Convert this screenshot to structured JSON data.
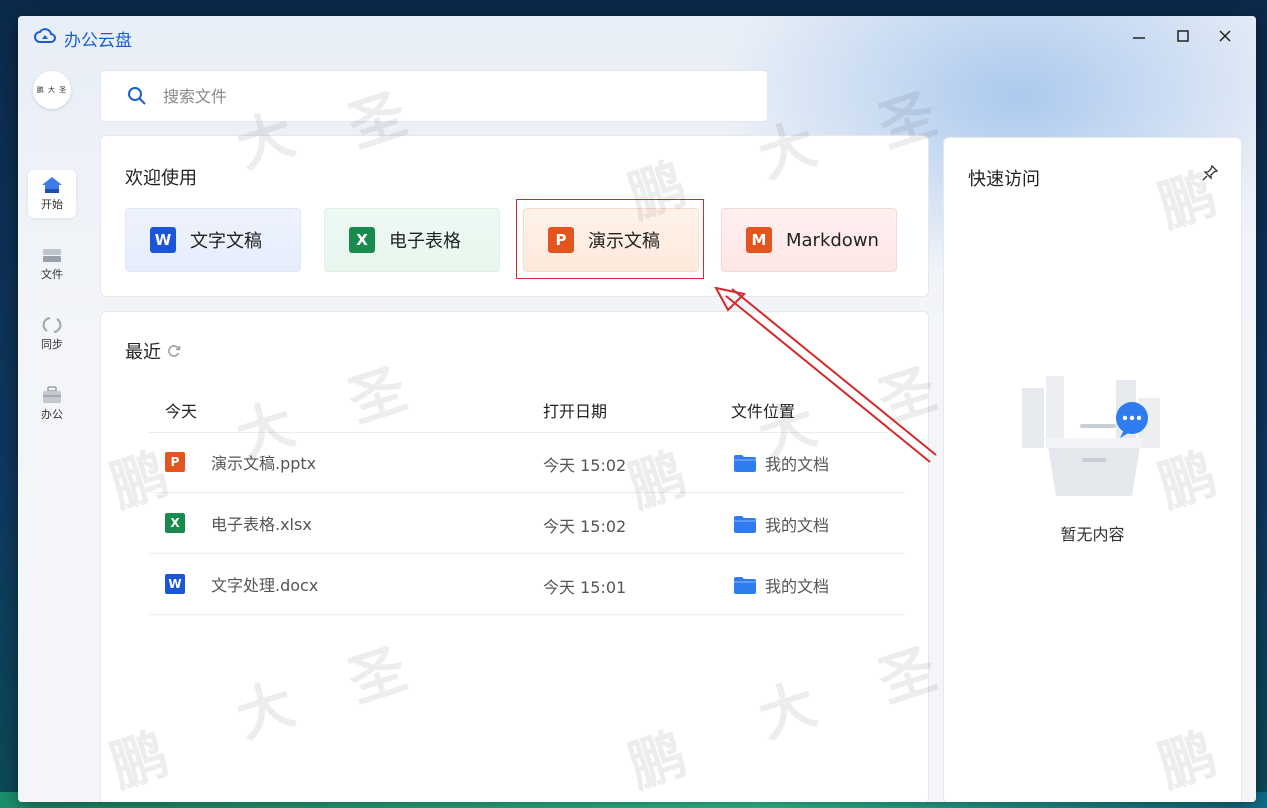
{
  "window": {
    "title": "办公云盘",
    "controls": [
      "minimize",
      "maximize",
      "close"
    ]
  },
  "sidebar": {
    "avatar_text": "鹏 大 圣",
    "items": [
      {
        "label": "开始",
        "icon": "home-icon",
        "active": true
      },
      {
        "label": "文件",
        "icon": "file-drawer-icon",
        "active": false
      },
      {
        "label": "同步",
        "icon": "sync-icon",
        "active": false
      },
      {
        "label": "办公",
        "icon": "briefcase-icon",
        "active": false
      }
    ]
  },
  "search": {
    "placeholder": "搜索文件",
    "value": ""
  },
  "welcome": {
    "title": "欢迎使用",
    "buttons": [
      {
        "label": "文字文稿",
        "icon_letter": "W",
        "icon": "word-icon"
      },
      {
        "label": "电子表格",
        "icon_letter": "X",
        "icon": "excel-icon"
      },
      {
        "label": "演示文稿",
        "icon_letter": "P",
        "icon": "ppt-icon"
      },
      {
        "label": "Markdown",
        "icon_letter": "M",
        "icon": "markdown-icon"
      }
    ],
    "highlighted": "演示文稿"
  },
  "recent": {
    "title": "最近",
    "columns": [
      "今天",
      "打开日期",
      "文件位置"
    ],
    "rows": [
      {
        "name": "演示文稿.pptx",
        "icon_letter": "P",
        "date": "今天 15:02",
        "location": "我的文档"
      },
      {
        "name": "电子表格.xlsx",
        "icon_letter": "X",
        "date": "今天 15:02",
        "location": "我的文档"
      },
      {
        "name": "文字处理.docx",
        "icon_letter": "W",
        "date": "今天 15:01",
        "location": "我的文档"
      }
    ]
  },
  "quick_access": {
    "title": "快速访问",
    "empty_text": "暂无内容"
  },
  "watermark": {
    "chars": [
      "鹏",
      "大",
      "圣"
    ]
  },
  "colors": {
    "accent": "#1d5fc9",
    "word": "#1b56d6",
    "excel": "#1a8b4f",
    "ppt": "#e3541e",
    "annotation": "#d42a2a"
  }
}
